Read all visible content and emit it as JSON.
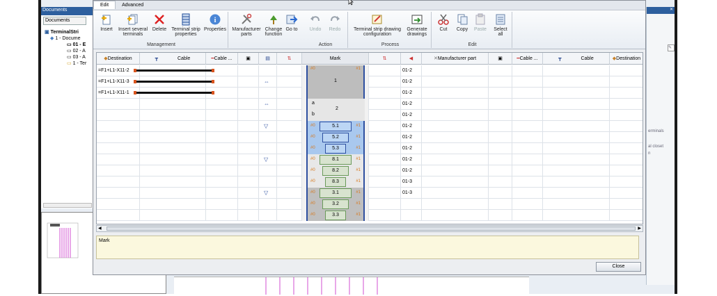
{
  "documents_panel": {
    "title": "Documents",
    "tab_label": "Documents"
  },
  "tree": [
    {
      "label": "TerminalStri",
      "bold": true,
      "indent": 0
    },
    {
      "label": "1 - Docume",
      "bold": false,
      "indent": 1
    },
    {
      "label": "01 - E",
      "bold": true,
      "indent": 2
    },
    {
      "label": "02 - A",
      "bold": false,
      "indent": 2
    },
    {
      "label": "03 - A",
      "bold": false,
      "indent": 2
    },
    {
      "label": "1 - Ter",
      "bold": false,
      "indent": 2
    }
  ],
  "right_panel": [
    "erminals",
    "al closet",
    "n"
  ],
  "menu": {
    "edit": "Edit",
    "advanced": "Advanced"
  },
  "ribbon": {
    "insert": "Insert",
    "insert_several": "Insert several terminals",
    "delete": "Delete",
    "strip_props": "Terminal strip properties",
    "properties": "Properties",
    "group_management": "Management",
    "mfr_parts": "Manufacturer parts",
    "change_function": "Change function",
    "goto": "Go to",
    "undo": "Undo",
    "redo": "Redo",
    "group_action": "Action",
    "drawing_config": "Terminal strip drawing configuration",
    "generate": "Generate drawings",
    "group_process": "Process",
    "cut": "Cut",
    "copy": "Copy",
    "paste": "Paste",
    "select_all": "Select all",
    "group_edit": "Edit"
  },
  "headers": {
    "destination": "Destination",
    "cable": "Cable",
    "cable_dots": "Cable ...",
    "mark": "Mark",
    "manufacturer_part": "Manufacturer part"
  },
  "rows": [
    {
      "dest": "=F1+L1-X11-2",
      "level": "01-2"
    },
    {
      "dest": "=F1+L1-X11-3",
      "level": "01-2"
    },
    {
      "dest": "=F1+L1-X11-1",
      "level": "01-2"
    },
    {
      "dest": "",
      "level": "01-2"
    },
    {
      "dest": "",
      "level": "01-2"
    },
    {
      "dest": "",
      "level": "01-2"
    },
    {
      "dest": "",
      "level": "01-2"
    },
    {
      "dest": "",
      "level": "01-2"
    },
    {
      "dest": "",
      "level": "01-2"
    },
    {
      "dest": "",
      "level": "01-2"
    },
    {
      "dest": "",
      "level": "01-3"
    },
    {
      "dest": "",
      "level": "01-3"
    },
    {
      "dest": "",
      "level": ""
    },
    {
      "dest": "",
      "level": ""
    }
  ],
  "marks": {
    "m1": "1",
    "m2": "2",
    "m2a": "a",
    "m2b": "b",
    "m51": "5.1",
    "m52": "5.2",
    "m53": "5.3",
    "m81": "8.1",
    "m82": "8.2",
    "m83": "8.3",
    "m31": "3.1",
    "m32": "3.2",
    "m33": "3.3",
    "left_tag": "#0",
    "right_tag": "#1"
  },
  "notes_label": "Mark",
  "close_label": "Close",
  "colors": {
    "blue_terminal": "#a9c8ee",
    "green_terminal": "#d8e3cf",
    "gray_terminal": "#bfbfbf",
    "brace": "#2d4fa0"
  }
}
